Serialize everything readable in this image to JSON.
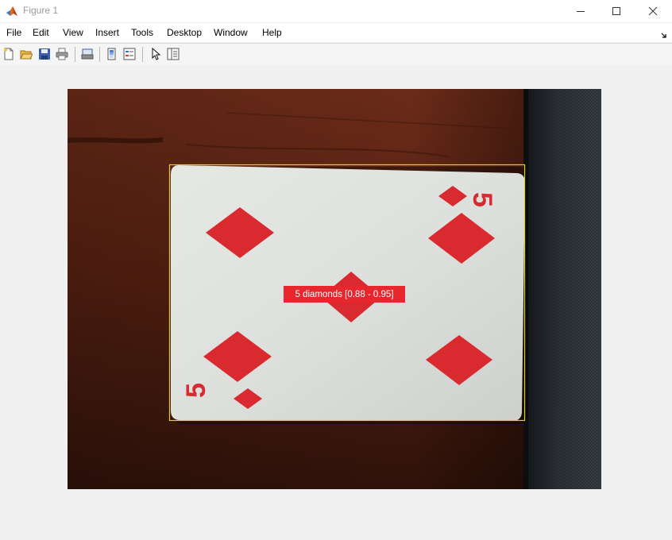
{
  "window": {
    "title": "Figure 1"
  },
  "menu": {
    "items": [
      "File",
      "Edit",
      "View",
      "Insert",
      "Tools",
      "Desktop",
      "Window",
      "Help"
    ]
  },
  "toolbar": {
    "buttons": [
      "new-figure-icon",
      "open-file-icon",
      "save-icon",
      "print-icon",
      "link-print-icon",
      "colorbar-icon",
      "legend-icon",
      "pointer-icon",
      "property-inspector-icon"
    ]
  },
  "detection": {
    "label": "5 diamonds [0.88 - 0.95]",
    "box_color": "#e6d200",
    "label_color": "#e8262e"
  },
  "card": {
    "rank": "5",
    "suit": "diamonds"
  },
  "colors": {
    "accent": "#e8262e",
    "suit_red": "#d92a30",
    "table_wood": "#5a2414"
  }
}
